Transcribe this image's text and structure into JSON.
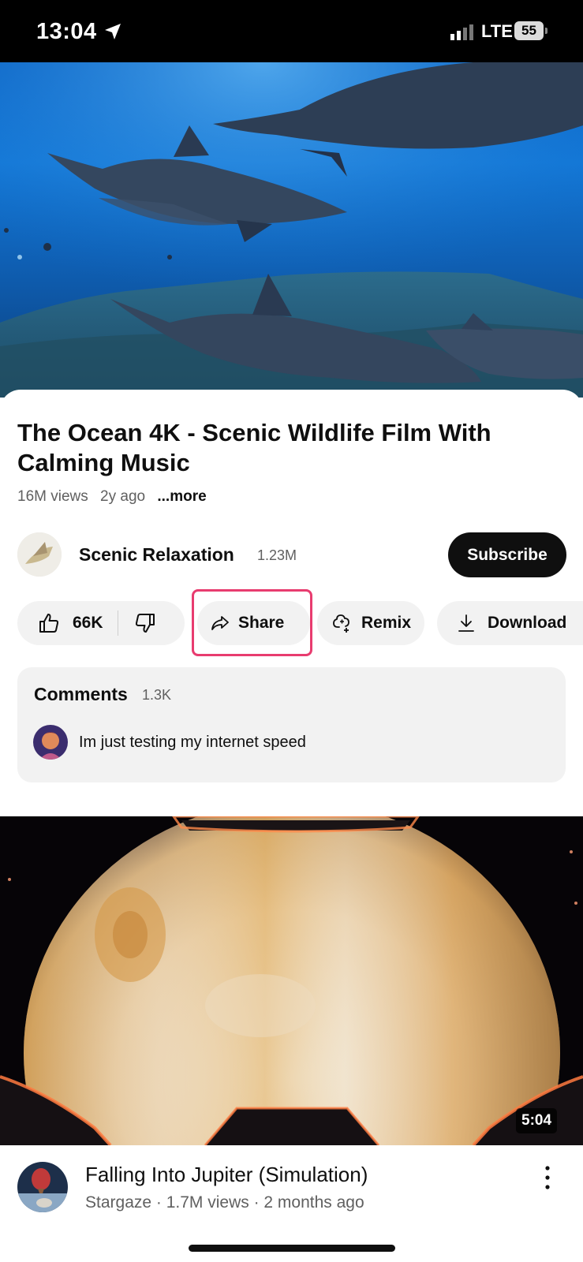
{
  "status_bar": {
    "time": "13:04",
    "network": "LTE",
    "battery": "55"
  },
  "current_video": {
    "title": "The Ocean 4K - Scenic Wildlife Film With Calming Music",
    "views": "16M views",
    "age": "2y ago",
    "more_label": "...more"
  },
  "channel": {
    "name": "Scenic Relaxation",
    "subscribers": "1.23M",
    "subscribe_label": "Subscribe"
  },
  "actions": {
    "like_count": "66K",
    "share_label": "Share",
    "remix_label": "Remix",
    "download_label": "Download",
    "highlight_color": "#e83c6f"
  },
  "comments": {
    "title": "Comments",
    "count": "1.3K",
    "top_comment": "Im just testing my internet speed"
  },
  "next_video": {
    "duration": "5:04",
    "title": "Falling Into Jupiter (Simulation)",
    "channel": "Stargaze",
    "meta": "Stargaze · 1.7M views · 2 months ago"
  },
  "icons": [
    "location-arrow-icon",
    "signal-icon",
    "battery-icon",
    "thumbs-up-icon",
    "thumbs-down-icon",
    "share-arrow-icon",
    "remix-icon",
    "download-icon",
    "more-vertical-icon"
  ]
}
